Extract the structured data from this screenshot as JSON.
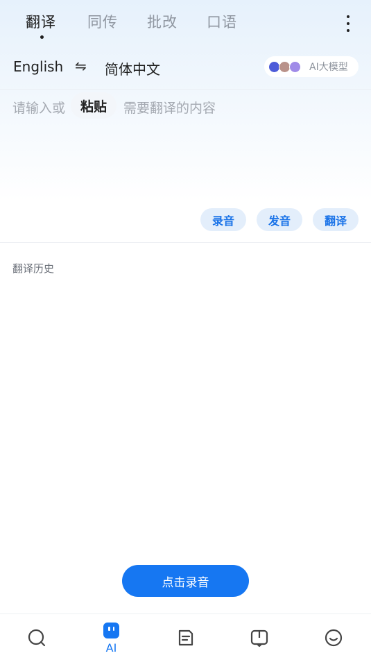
{
  "tabs": [
    {
      "label": "翻译",
      "active": true
    },
    {
      "label": "同传",
      "active": false
    },
    {
      "label": "批改",
      "active": false
    },
    {
      "label": "口语",
      "active": false
    }
  ],
  "language": {
    "source": "English",
    "swap_icon": "⇋",
    "target": "简体中文"
  },
  "model_badge": {
    "label": "AI大模型",
    "icons": [
      "deepseek-icon",
      "avatar-icon",
      "star-model-icon"
    ]
  },
  "input": {
    "placeholder_before": "请输入或",
    "paste_label": "粘贴",
    "placeholder_after": "需要翻译的内容"
  },
  "actions": {
    "record": "录音",
    "speak": "发音",
    "translate": "翻译"
  },
  "history": {
    "title": "翻译历史"
  },
  "record_button": {
    "label": "点击录音"
  },
  "bottom_nav": {
    "items": [
      {
        "icon": "search-icon"
      },
      {
        "icon": "ai-icon",
        "label": "AI",
        "active": true
      },
      {
        "icon": "document-icon"
      },
      {
        "icon": "book-icon"
      },
      {
        "icon": "smile-icon"
      }
    ]
  },
  "colors": {
    "accent": "#1677f2",
    "action_bg": "#e3eefb",
    "inactive_text": "#8f96a0"
  }
}
